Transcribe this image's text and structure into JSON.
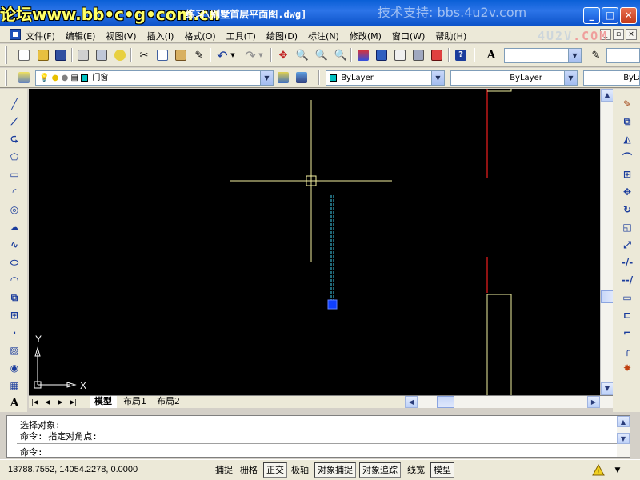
{
  "titlebar": {
    "watermark_left_a": "论坛",
    "watermark_left_b": "www.bb•c•g•com.cn",
    "title_tail": "练习\\别墅首层平面图.dwg]",
    "watermark_right": "技术支持: bbs.4u2v.com",
    "watermark_logo_a": "4U2V",
    "watermark_logo_b": ".COM",
    "min_label": "_",
    "max_label": "□",
    "close_label": "✕"
  },
  "menu": {
    "items": [
      "文件(F)",
      "编辑(E)",
      "视图(V)",
      "插入(I)",
      "格式(O)",
      "工具(T)",
      "绘图(D)",
      "标注(N)",
      "修改(M)",
      "窗口(W)",
      "帮助(H)"
    ]
  },
  "toolbar_standard": {
    "textstyle_value": "",
    "dimstyle_value": ""
  },
  "toolbar_layers": {
    "layer_name": "门窗",
    "color_value": "ByLayer",
    "linetype_value": "ByLayer",
    "lineweight_value": "ByLa"
  },
  "canvas": {
    "background": "#000000",
    "crosshair_color": "#f4f0a0",
    "wall_red_color": "#c01818",
    "wall_yellow_color": "#f0f0a0",
    "dashed_color": "#40d0f0",
    "grip_color": "#1040ff",
    "ucs_y": "Y",
    "ucs_x": "X"
  },
  "tabs": {
    "nav": [
      "|◀",
      "◀",
      "▶",
      "▶|"
    ],
    "items": [
      "模型",
      "布局1",
      "布局2"
    ],
    "active": "模型"
  },
  "command": {
    "line1": "选择对象:",
    "line2": "命令: 指定对角点:",
    "prompt": "命令:"
  },
  "status": {
    "coords": "13788.7552, 14054.2278, 0.0000",
    "toggles": [
      {
        "label": "捕捉",
        "on": false
      },
      {
        "label": "栅格",
        "on": false
      },
      {
        "label": "正交",
        "on": true
      },
      {
        "label": "极轴",
        "on": false
      },
      {
        "label": "对象捕捉",
        "on": true
      },
      {
        "label": "对象追踪",
        "on": true
      },
      {
        "label": "线宽",
        "on": false
      },
      {
        "label": "模型",
        "on": true
      }
    ]
  }
}
